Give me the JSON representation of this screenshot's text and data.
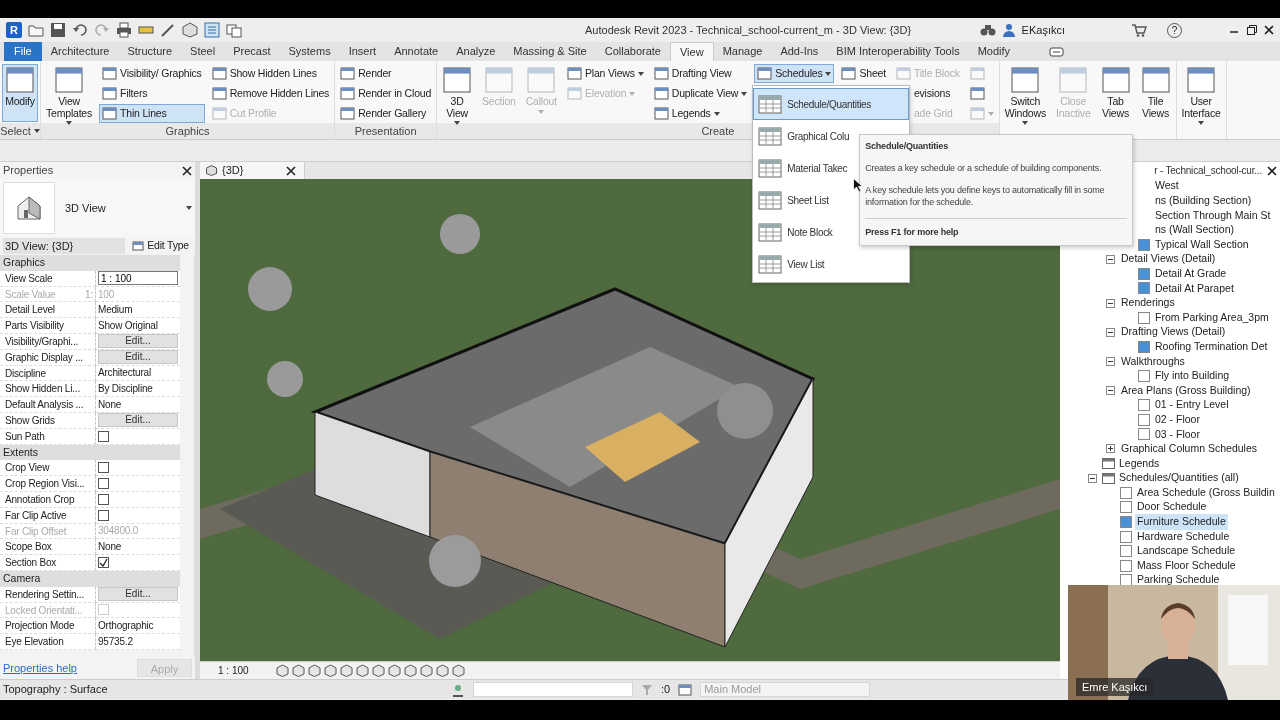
{
  "title_bar": {
    "app_letter": "R",
    "title": "Autodesk Revit 2023 - Technical_school-current_m - 3D View: {3D}",
    "user": "EKaşıkcı",
    "help": "?"
  },
  "menu_tabs": [
    {
      "label": "File",
      "kind": "file",
      "selected": false
    },
    {
      "label": "Architecture",
      "kind": "tab",
      "selected": false
    },
    {
      "label": "Structure",
      "kind": "tab",
      "selected": false
    },
    {
      "label": "Steel",
      "kind": "tab",
      "selected": false
    },
    {
      "label": "Precast",
      "kind": "tab",
      "selected": false
    },
    {
      "label": "Systems",
      "kind": "tab",
      "selected": false
    },
    {
      "label": "Insert",
      "kind": "tab",
      "selected": false
    },
    {
      "label": "Annotate",
      "kind": "tab",
      "selected": false
    },
    {
      "label": "Analyze",
      "kind": "tab",
      "selected": false
    },
    {
      "label": "Massing & Site",
      "kind": "tab",
      "selected": false
    },
    {
      "label": "Collaborate",
      "kind": "tab",
      "selected": false
    },
    {
      "label": "View",
      "kind": "tab",
      "selected": true
    },
    {
      "label": "Manage",
      "kind": "tab",
      "selected": false
    },
    {
      "label": "Add-Ins",
      "kind": "tab",
      "selected": false
    },
    {
      "label": "BIM Interoperability Tools",
      "kind": "tab",
      "selected": false
    },
    {
      "label": "Modify",
      "kind": "tab",
      "selected": false
    }
  ],
  "ribbon": {
    "panels": [
      {
        "label": "Select",
        "label_dropdown": true,
        "columns": [
          [
            {
              "label": "Modify",
              "kind": "large",
              "active": true,
              "disabled": false,
              "dropdown": false
            }
          ]
        ]
      },
      {
        "label": "Graphics",
        "label_dropdown": false,
        "columns": [
          [
            {
              "label": "View Templates",
              "kind": "large",
              "active": false,
              "disabled": false,
              "dropdown": true
            }
          ],
          [
            {
              "label": "Visibility/ Graphics",
              "kind": "small",
              "active": false,
              "disabled": false,
              "dropdown": false
            },
            {
              "label": "Filters",
              "kind": "small",
              "active": false,
              "disabled": false,
              "dropdown": false
            },
            {
              "label": "Thin Lines",
              "kind": "small",
              "active": true,
              "disabled": false,
              "dropdown": false
            }
          ],
          [
            {
              "label": "Show Hidden Lines",
              "kind": "small",
              "active": false,
              "disabled": false,
              "dropdown": false
            },
            {
              "label": "Remove Hidden Lines",
              "kind": "small",
              "active": false,
              "disabled": false,
              "dropdown": false
            },
            {
              "label": "Cut Profile",
              "kind": "small",
              "active": false,
              "disabled": true,
              "dropdown": false
            }
          ]
        ]
      },
      {
        "label": "Presentation",
        "label_dropdown": false,
        "columns": [
          [
            {
              "label": "Render",
              "kind": "small",
              "active": false,
              "disabled": false,
              "dropdown": false
            },
            {
              "label": "Render in Cloud",
              "kind": "small",
              "active": false,
              "disabled": false,
              "dropdown": false
            },
            {
              "label": "Render Gallery",
              "kind": "small",
              "active": false,
              "disabled": false,
              "dropdown": false
            }
          ]
        ]
      },
      {
        "label": "Create",
        "label_dropdown": false,
        "columns": [
          [
            {
              "label": "3D View",
              "kind": "large",
              "active": false,
              "disabled": false,
              "dropdown": true
            }
          ],
          [
            {
              "label": "Section",
              "kind": "large",
              "active": false,
              "disabled": true,
              "dropdown": false
            }
          ],
          [
            {
              "label": "Callout",
              "kind": "large",
              "active": false,
              "disabled": true,
              "dropdown": true
            }
          ],
          [
            {
              "label": "Plan Views",
              "kind": "small",
              "active": false,
              "disabled": false,
              "dropdown": true
            },
            {
              "label": "Elevation",
              "kind": "small",
              "active": false,
              "disabled": true,
              "dropdown": true
            }
          ],
          [
            {
              "label": "Drafting View",
              "kind": "small",
              "active": false,
              "disabled": false,
              "dropdown": false
            },
            {
              "label": "Duplicate View",
              "kind": "small",
              "active": false,
              "disabled": false,
              "dropdown": true
            },
            {
              "label": "Legends",
              "kind": "small",
              "active": false,
              "disabled": false,
              "dropdown": true
            }
          ],
          [
            {
              "label": "Schedules",
              "kind": "small",
              "active": true,
              "disabled": false,
              "dropdown": true
            }
          ],
          [
            {
              "label": "Sheet",
              "kind": "small",
              "active": false,
              "disabled": false,
              "dropdown": false
            }
          ],
          [
            {
              "label": "Title Block",
              "kind": "small",
              "active": false,
              "disabled": true,
              "dropdown": false
            },
            {
              "label": "evisions",
              "kind": "cut",
              "active": false,
              "disabled": false,
              "dropdown": false
            },
            {
              "label": "ade Grid",
              "kind": "cut",
              "active": false,
              "disabled": true,
              "dropdown": false
            }
          ],
          [
            {
              "kind": "icon",
              "active": false,
              "disabled": true,
              "dropdown": false
            },
            {
              "kind": "icon",
              "active": false,
              "disabled": false,
              "dropdown": false
            },
            {
              "kind": "icon",
              "active": false,
              "disabled": true,
              "dropdown": true
            }
          ]
        ]
      },
      {
        "columns": [
          [
            {
              "label": "Switch Windows",
              "kind": "large",
              "active": false,
              "disabled": false,
              "dropdown": true
            }
          ],
          [
            {
              "label": "Close Inactive",
              "kind": "large",
              "active": false,
              "disabled": true,
              "dropdown": false
            }
          ],
          [
            {
              "label": "Tab Views",
              "kind": "large",
              "active": false,
              "disabled": false,
              "dropdown": false
            }
          ],
          [
            {
              "label": "Tile Views",
              "kind": "large",
              "active": false,
              "disabled": false,
              "dropdown": false
            }
          ]
        ]
      },
      {
        "columns": [
          [
            {
              "label": "User Interface",
              "kind": "large",
              "active": false,
              "disabled": false,
              "dropdown": true
            }
          ]
        ]
      }
    ]
  },
  "schedules_menu": {
    "items": [
      {
        "label": "Schedule/Quantities",
        "selected": true
      },
      {
        "label": "Graphical Colu",
        "selected": false
      },
      {
        "label": "Material Takec",
        "selected": false
      },
      {
        "label": "Sheet List",
        "selected": false
      },
      {
        "label": "Note Block",
        "selected": false
      },
      {
        "label": "View List",
        "selected": false
      }
    ]
  },
  "tooltip": {
    "title": "Schedule/Quantities",
    "summary": "Creates a key schedule or a schedule of building components.",
    "detail": "A key schedule lets you define keys to automatically fill in some information for the schedule.",
    "help": "Press F1 for more help"
  },
  "properties": {
    "title": "Properties",
    "type_name": "3D View",
    "instance": "3D View: {3D}",
    "edit_type": "Edit Type",
    "rows": [
      {
        "kind": "section",
        "label": "Graphics"
      },
      {
        "kind": "input",
        "label": "View Scale",
        "value": "1 : 100",
        "disabled": false
      },
      {
        "kind": "text",
        "label": "Scale Value",
        "suffix": "1:",
        "value": "100",
        "disabled": true
      },
      {
        "kind": "text",
        "label": "Detail Level",
        "value": "Medium",
        "disabled": false
      },
      {
        "kind": "text",
        "label": "Parts Visibility",
        "value": "Show Original",
        "disabled": false
      },
      {
        "kind": "edit",
        "label": "Visibility/Graphi...",
        "value": "Edit...",
        "disabled": false
      },
      {
        "kind": "edit",
        "label": "Graphic Display ...",
        "value": "Edit...",
        "disabled": false
      },
      {
        "kind": "text",
        "label": "Discipline",
        "value": "Architectural",
        "disabled": false
      },
      {
        "kind": "text",
        "label": "Show Hidden Li...",
        "value": "By Discipline",
        "disabled": false
      },
      {
        "kind": "text",
        "label": "Default Analysis ...",
        "value": "None",
        "disabled": false
      },
      {
        "kind": "edit",
        "label": "Show Grids",
        "value": "Edit...",
        "disabled": false
      },
      {
        "kind": "check",
        "label": "Sun Path",
        "checked": false,
        "disabled": false
      },
      {
        "kind": "section",
        "label": "Extents"
      },
      {
        "kind": "check",
        "label": "Crop View",
        "checked": false,
        "disabled": false
      },
      {
        "kind": "check",
        "label": "Crop Region Visi...",
        "checked": false,
        "disabled": false
      },
      {
        "kind": "check",
        "label": "Annotation Crop",
        "checked": false,
        "disabled": false
      },
      {
        "kind": "check",
        "label": "Far Clip Active",
        "checked": false,
        "disabled": false
      },
      {
        "kind": "text",
        "label": "Far Clip Offset",
        "value": "304800.0",
        "disabled": true
      },
      {
        "kind": "text",
        "label": "Scope Box",
        "value": "None",
        "disabled": false
      },
      {
        "kind": "check",
        "label": "Section Box",
        "checked": true,
        "disabled": false
      },
      {
        "kind": "section",
        "label": "Camera"
      },
      {
        "kind": "edit",
        "label": "Rendering Settin...",
        "value": "Edit...",
        "disabled": false
      },
      {
        "kind": "check",
        "label": "Locked Orientati...",
        "checked": false,
        "disabled": true
      },
      {
        "kind": "text",
        "label": "Projection Mode",
        "value": "Orthographic",
        "disabled": false
      },
      {
        "kind": "text",
        "label": "Eye Elevation",
        "value": "95735.2",
        "disabled": false
      }
    ],
    "help_link": "Properties help",
    "apply": "Apply",
    "apply_disabled": true
  },
  "view_tab": {
    "label": "{3D}"
  },
  "view_bar": {
    "scale": "1 : 100"
  },
  "project_browser": {
    "title": "r - Technical_school-cur...",
    "tree": [
      {
        "children": [
          {
            "children": [
              {
                "label": "West",
                "kind": "label",
                "selected": false
              },
              {
                "label": "ns (Building Section)",
                "kind": "label",
                "selected": false
              },
              {
                "label": "Section Through Main St",
                "kind": "label",
                "selected": false
              },
              {
                "label": "ns (Wall Section)",
                "kind": "label",
                "selected": false
              },
              {
                "label": "Typical Wall Section",
                "kind": "view",
                "filled": true,
                "selected": false
              }
            ]
          },
          {
            "label": "Detail Views (Detail)",
            "kind": "group",
            "expanded": true,
            "selected": false,
            "children": [
              {
                "label": "Detail At Grade",
                "kind": "view",
                "filled": true,
                "selected": false
              },
              {
                "label": "Detail At Parapet",
                "kind": "view",
                "filled": true,
                "selected": false
              }
            ]
          },
          {
            "label": "Renderings",
            "kind": "group",
            "expanded": true,
            "selected": false,
            "children": [
              {
                "label": "From Parking Area_3pm",
                "kind": "view",
                "filled": false,
                "selected": false
              }
            ]
          },
          {
            "label": "Drafting Views (Detail)",
            "kind": "group",
            "expanded": true,
            "selected": false,
            "children": [
              {
                "label": "Roofing Termination Det",
                "kind": "view",
                "filled": true,
                "selected": false
              }
            ]
          },
          {
            "label": "Walkthroughs",
            "kind": "group",
            "expanded": true,
            "selected": false,
            "children": [
              {
                "label": "Fly into Building",
                "kind": "view",
                "filled": false,
                "selected": false
              }
            ]
          },
          {
            "label": "Area Plans (Gross Building)",
            "kind": "group",
            "expanded": true,
            "selected": false,
            "children": [
              {
                "label": "01 - Entry Level",
                "kind": "view",
                "filled": false,
                "selected": false
              },
              {
                "label": "02 - Floor",
                "kind": "view",
                "filled": false,
                "selected": false
              },
              {
                "label": "03 - Floor",
                "kind": "view",
                "filled": false,
                "selected": false
              }
            ]
          },
          {
            "label": "Graphical Column Schedules",
            "kind": "group",
            "expanded": false,
            "selected": false
          }
        ]
      },
      {
        "label": "Legends",
        "kind": "category",
        "selected": false
      },
      {
        "label": "Schedules/Quantities (all)",
        "kind": "category",
        "expanded": true,
        "selected": false,
        "children": [
          {
            "label": "Area Schedule (Gross Buildin",
            "kind": "view",
            "filled": false,
            "selected": false
          },
          {
            "label": "Door Schedule",
            "kind": "view",
            "filled": false,
            "selected": false
          },
          {
            "label": "Furniture Schedule",
            "kind": "view",
            "filled": true,
            "selected": true
          },
          {
            "label": "Hardware Schedule",
            "kind": "view",
            "filled": false,
            "selected": false
          },
          {
            "label": "Landscape Schedule",
            "kind": "view",
            "filled": false,
            "selected": false
          },
          {
            "label": "Mass Floor Schedule",
            "kind": "view",
            "filled": false,
            "selected": false
          },
          {
            "label": "Parking Schedule",
            "kind": "view",
            "filled": false,
            "selected": false
          }
        ]
      }
    ]
  },
  "status_bar": {
    "selection": "Topography : Surface",
    "filter_count": ":0",
    "model": "Main Model",
    "model_disabled": true
  },
  "webcam": {
    "name": "Emre Kaşıkcı"
  }
}
